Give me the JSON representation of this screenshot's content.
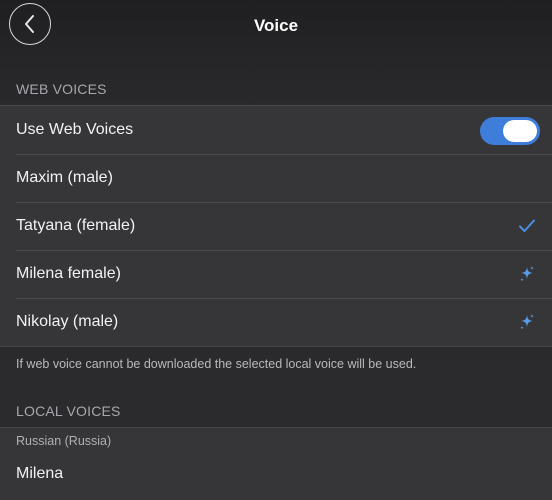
{
  "nav": {
    "title": "Voice",
    "back_icon": "chevron-left-icon"
  },
  "web_voices": {
    "header": "WEB VOICES",
    "toggle": {
      "label": "Use Web Voices",
      "on": true,
      "color": "#3f7ddb"
    },
    "items": [
      {
        "label": "Maxim (male)",
        "icon": ""
      },
      {
        "label": "Tatyana (female)",
        "icon": "checkmark-icon"
      },
      {
        "label": "Milena female)",
        "icon": "sparkle-icon"
      },
      {
        "label": "Nikolay (male)",
        "icon": "sparkle-icon"
      }
    ],
    "footer": "If web voice cannot be downloaded the selected local voice will be used."
  },
  "local_voices": {
    "header": "LOCAL VOICES",
    "language": "Russian (Russia)",
    "items": [
      {
        "label": "Milena"
      }
    ]
  },
  "colors": {
    "accent": "#4a90e2",
    "background": "#2b2b2d",
    "cell": "#363638"
  }
}
